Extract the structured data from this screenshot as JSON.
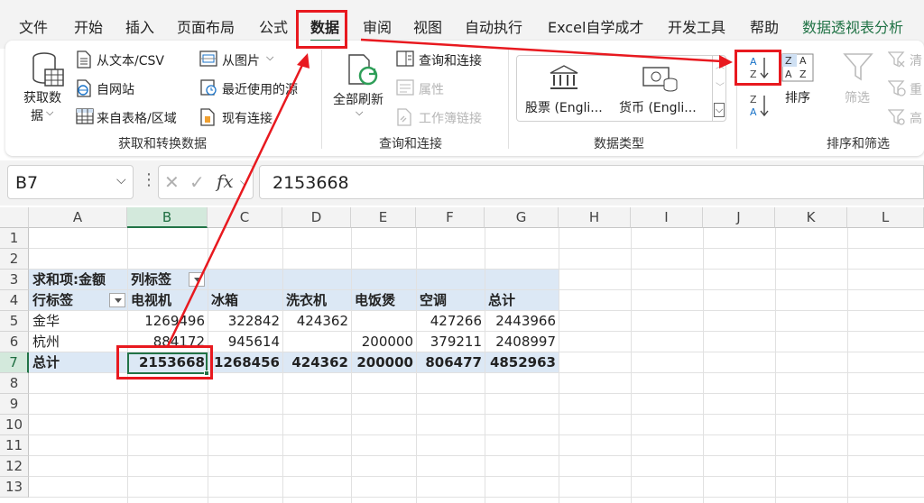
{
  "menu": {
    "items": [
      "文件",
      "开始",
      "插入",
      "页面布局",
      "公式",
      "数据",
      "审阅",
      "视图",
      "自动执行",
      "Excel自学成才",
      "开发工具",
      "帮助",
      "数据透视表分析"
    ],
    "active_index": 5
  },
  "ribbon": {
    "get_data": {
      "button_line1": "获取数",
      "button_line2": "据",
      "from_text": "从文本/CSV",
      "from_web": "自网站",
      "from_table": "来自表格/区域",
      "from_picture": "从图片",
      "recent_sources": "最近使用的源",
      "existing_connections": "现有连接",
      "group_label": "获取和转换数据"
    },
    "queries": {
      "refresh_all": "全部刷新",
      "queries_connections": "查询和连接",
      "properties": "属性",
      "workbook_links": "工作簿链接",
      "group_label": "查询和连接"
    },
    "data_types": {
      "stocks": "股票 (Engli...",
      "currencies": "货币 (Engli...",
      "group_label": "数据类型"
    },
    "sort_filter": {
      "sort": "排序",
      "filter": "筛选",
      "clear": "清",
      "reapply": "重",
      "advanced": "高",
      "group_label": "排序和筛选"
    }
  },
  "formula_bar": {
    "name_box": "B7",
    "fx": "fx",
    "value": "2153668"
  },
  "grid": {
    "columns": [
      "A",
      "B",
      "C",
      "D",
      "E",
      "F",
      "G",
      "H",
      "I",
      "J",
      "K",
      "L"
    ],
    "rows": [
      "1",
      "2",
      "3",
      "4",
      "5",
      "6",
      "7",
      "8",
      "9",
      "10",
      "11",
      "12",
      "13"
    ],
    "selected_column": "B",
    "selected_row": "7"
  },
  "pivot": {
    "sum_label": "求和项:金额",
    "col_label": "列标签",
    "row_label": "行标签",
    "headers": [
      "电视机",
      "冰箱",
      "洗衣机",
      "电饭煲",
      "空调",
      "总计"
    ],
    "rows": [
      {
        "label": "金华",
        "values": [
          "1269496",
          "322842",
          "424362",
          "",
          "427266",
          "2443966"
        ]
      },
      {
        "label": "杭州",
        "values": [
          "884172",
          "945614",
          "",
          "200000",
          "379211",
          "2408997"
        ]
      }
    ],
    "total": {
      "label": "总计",
      "values": [
        "2153668",
        "1268456",
        "424362",
        "200000",
        "806477",
        "4852963"
      ]
    }
  },
  "colors": {
    "accent": "#217346",
    "annotation": "#e8191f",
    "pivot_fill": "#dce8f5"
  }
}
